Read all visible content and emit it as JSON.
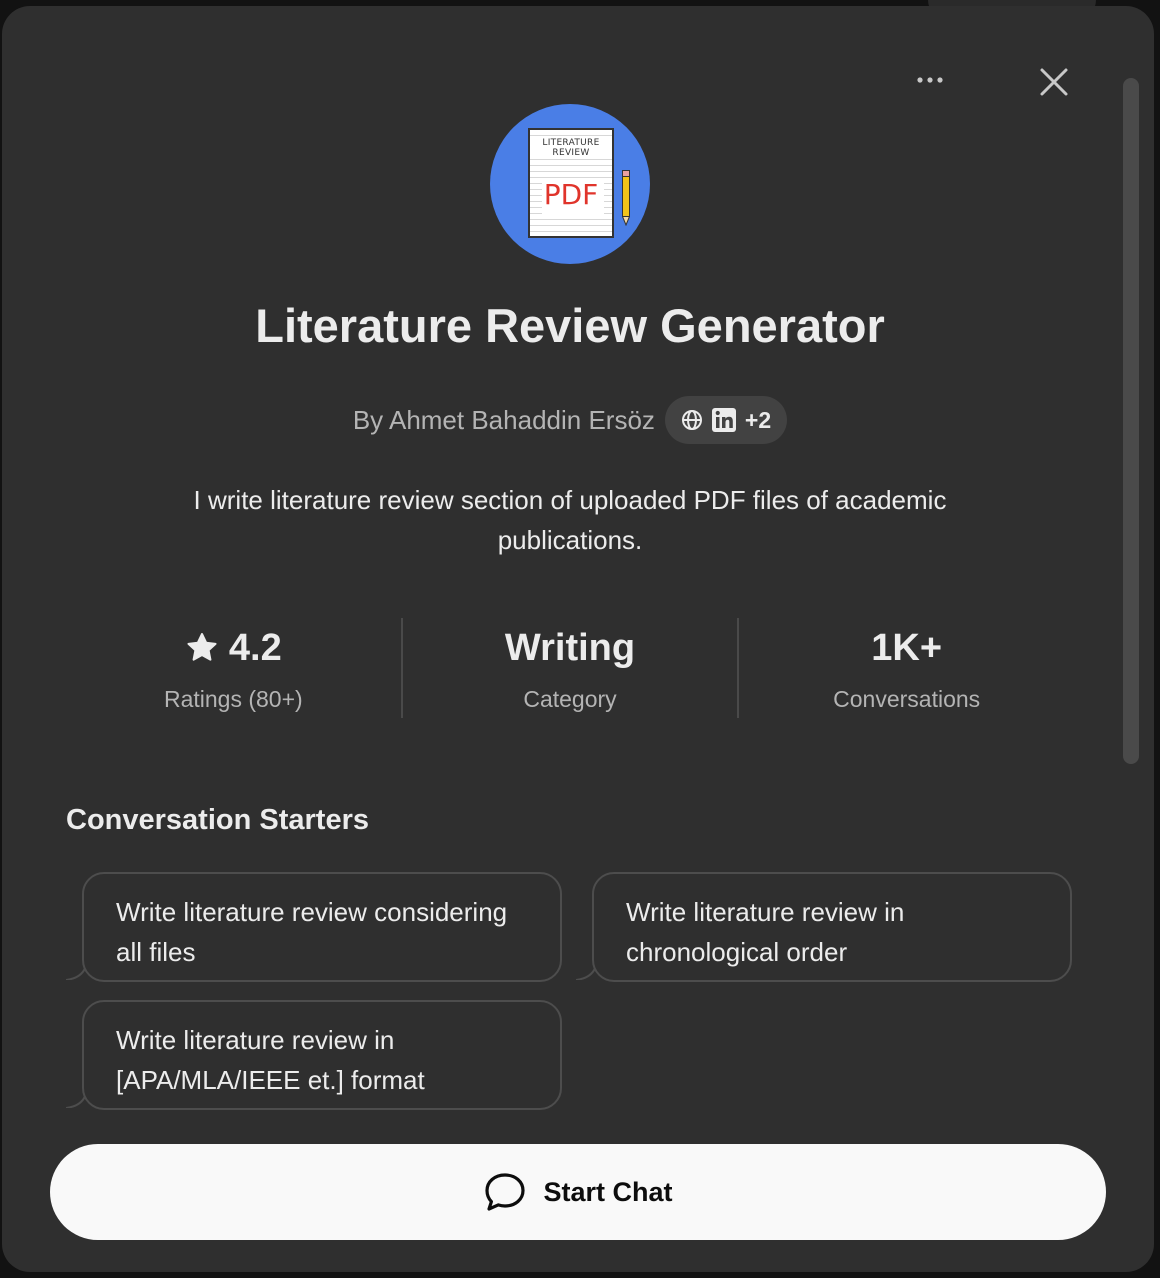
{
  "header": {
    "more_icon": "more-horizontal-icon",
    "close_icon": "close-icon"
  },
  "avatar": {
    "paper_title_line1": "LITERATURE",
    "paper_title_line2": "REVIEW",
    "paper_badge": "PDF",
    "colors": {
      "circle": "#4a7ee6",
      "pdf_text": "#e0342b",
      "pencil": "#f2c318"
    }
  },
  "title": "Literature Review Generator",
  "byline": {
    "author": "By Ahmet Bahaddin Ersöz",
    "extra_links": "+2",
    "icons": [
      "globe-icon",
      "linkedin-icon"
    ]
  },
  "description": "I write literature review section of uploaded PDF files of academic publications.",
  "stats": [
    {
      "value": "4.2",
      "label": "Ratings (80+)",
      "icon": "star-icon"
    },
    {
      "value": "Writing",
      "label": "Category"
    },
    {
      "value": "1K+",
      "label": "Conversations"
    }
  ],
  "conversation_starters": {
    "heading": "Conversation Starters",
    "items": [
      "Write literature review considering all files",
      "Write literature review in chronological order",
      "Write literature review in [APA/MLA/IEEE et.] format"
    ]
  },
  "start_chat": {
    "label": "Start Chat",
    "icon": "chat-bubble-icon"
  },
  "colors": {
    "modal_bg": "#2f2f2f",
    "text_primary": "#ececec",
    "text_secondary": "#b4b4b4",
    "button_bg": "#f9f9f9"
  }
}
